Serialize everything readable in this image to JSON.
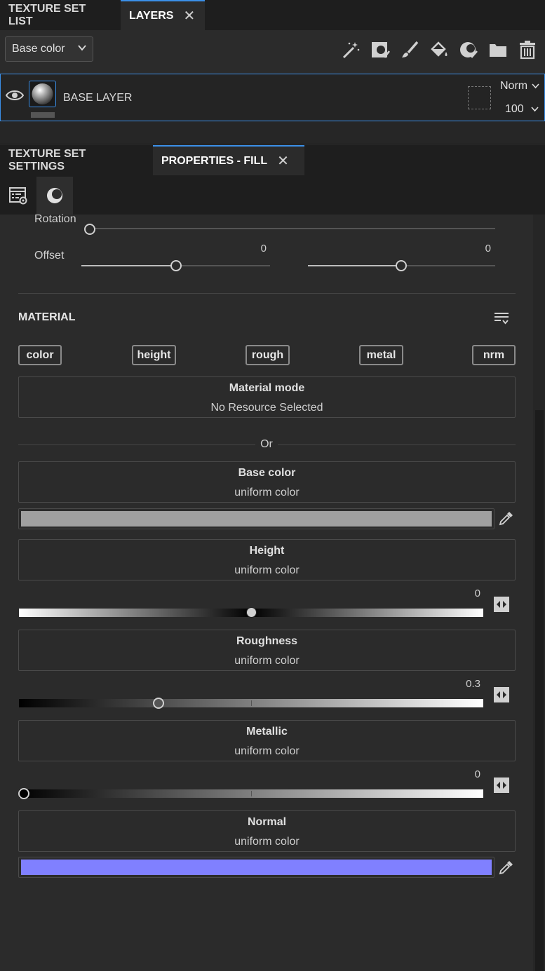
{
  "top_tabs": [
    {
      "label": "TEXTURE SET LIST"
    },
    {
      "label": "LAYERS"
    }
  ],
  "toolbar": {
    "channel_select": "Base color",
    "tools": [
      "magic-wand-icon",
      "add-mask-icon",
      "paint-icon",
      "fill-icon",
      "smart-material-icon",
      "folder-icon",
      "trash-icon"
    ]
  },
  "layer": {
    "name": "BASE LAYER",
    "blend_mode": "Norm",
    "opacity": "100"
  },
  "panel_tabs": [
    {
      "label": "TEXTURE SET SETTINGS"
    },
    {
      "label": "PROPERTIES - FILL"
    }
  ],
  "transform": {
    "rotation_label": "Rotation",
    "rotation_value": 0,
    "offset_label": "Offset",
    "offset_x": "0",
    "offset_y": "0"
  },
  "material": {
    "header": "MATERIAL",
    "channels": [
      "color",
      "height",
      "rough",
      "metal",
      "nrm"
    ],
    "mode_title": "Material mode",
    "mode_value": "No Resource Selected",
    "or_label": "Or"
  },
  "base_color": {
    "title": "Base color",
    "sub": "uniform color",
    "swatch": "#a0a0a0"
  },
  "height": {
    "title": "Height",
    "sub": "uniform color",
    "value": "0",
    "level": 0.5
  },
  "roughness": {
    "title": "Roughness",
    "sub": "uniform color",
    "value": "0.3",
    "level": 0.3
  },
  "metallic": {
    "title": "Metallic",
    "sub": "uniform color",
    "value": "0",
    "level": 0.0
  },
  "normal": {
    "title": "Normal",
    "sub": "uniform color",
    "swatch": "#8080ff"
  },
  "colors": {
    "accent": "#3b8fe8",
    "background": "#2b2b2b",
    "tabbar": "#1e1e1e"
  }
}
